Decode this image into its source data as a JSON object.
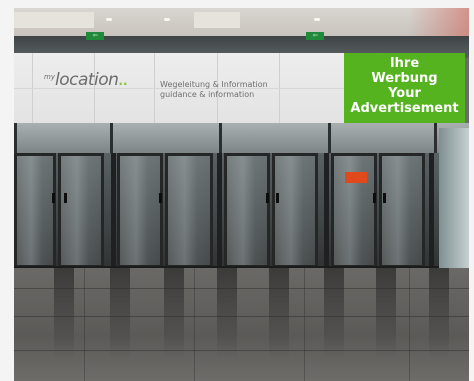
{
  "scene": {
    "description_tags": [
      "airport-terminal",
      "glass-doors",
      "digital-signage"
    ],
    "colors": {
      "ad_green": "#55b320",
      "exit_green": "#1f8a3a",
      "screen_white": "#e9e9e9"
    }
  },
  "signage": {
    "logo_prefix": "my",
    "logo_main": "location",
    "tagline_line1": "Wegeleitung & Information",
    "tagline_line2": "guidance & information",
    "ad_line1": "Ihre",
    "ad_line2": "Werbung",
    "ad_line3": "Your",
    "ad_line4": "Advertisement"
  },
  "exit_signs": [
    "exit-sign-left",
    "exit-sign-center"
  ]
}
